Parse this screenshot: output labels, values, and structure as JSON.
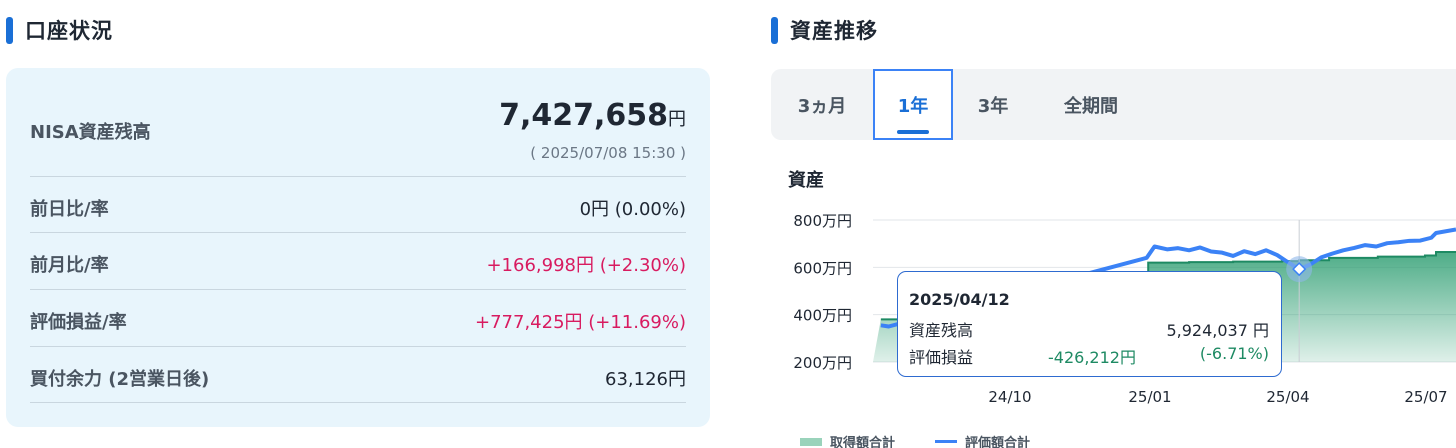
{
  "account": {
    "title": "口座状況",
    "nisa_label": "NISA資産残高",
    "nisa_value": "7,427,658",
    "nisa_unit": "円",
    "timestamp": "( 2025/07/08 15:30 )",
    "rows": [
      {
        "label": "前日比/率",
        "value": "0円 (0.00%)"
      },
      {
        "label": "前月比/率",
        "value": "+166,998円 (+2.30%)"
      },
      {
        "label": "評価損益/率",
        "value": "+777,425円 (+11.69%)"
      },
      {
        "label": "買付余力 (2営業日後)",
        "value": "63,126円"
      }
    ]
  },
  "history": {
    "title": "資産推移",
    "tabs": [
      "3ヵ月",
      "1年",
      "3年",
      "全期間"
    ],
    "active_tab": "1年",
    "chart_label": "資産",
    "tooltip": {
      "date": "2025/04/12",
      "row1_label": "資産残高",
      "row1_value": "5,924,037 円",
      "row2_label": "評価損益",
      "row2_value": "-426,212円",
      "row2_pct": "(-6.71%)"
    },
    "legend": [
      "取得額合計",
      "評価額合計"
    ]
  },
  "colors": {
    "accent": "#1a6fd6",
    "positive": "#d81b60",
    "negative_tooltip": "#1e8a63",
    "line": "#3b82f6",
    "area": "#2e9e72"
  },
  "chart_data": {
    "type": "line",
    "ylabel": "",
    "y_ticks": [
      "800万円",
      "600万円",
      "400万円",
      "200万円"
    ],
    "y_tick_values": [
      800,
      600,
      400,
      200
    ],
    "ylim": [
      200,
      800
    ],
    "x_ticks": [
      "24/10",
      "25/01",
      "25/04",
      "25/07"
    ],
    "x_tick_values": [
      "2024-10",
      "2025-01",
      "2025-04",
      "2025-07"
    ],
    "grid": true,
    "legend_position": "bottom",
    "series": [
      {
        "name": "取得額合計",
        "style": "area",
        "x": [
          "2024-07-20",
          "2024-08-15",
          "2024-09-15",
          "2024-10-15",
          "2024-11-15",
          "2024-12-15",
          "2025-01-05",
          "2025-01-06",
          "2025-02-01",
          "2025-03-01",
          "2025-04-01",
          "2025-04-12",
          "2025-05-01",
          "2025-06-01",
          "2025-07-01",
          "2025-07-08"
        ],
        "values": [
          380,
          380,
          380,
          380,
          380,
          380,
          380,
          620,
          622,
          624,
          626,
          630,
          640,
          645,
          650,
          665
        ]
      },
      {
        "name": "評価額合計",
        "style": "line",
        "x": [
          "2024-07-20",
          "2024-07-25",
          "2025-01-05",
          "2025-01-10",
          "2025-01-18",
          "2025-01-25",
          "2025-02-01",
          "2025-02-08",
          "2025-02-15",
          "2025-02-22",
          "2025-03-01",
          "2025-03-08",
          "2025-03-15",
          "2025-03-22",
          "2025-03-29",
          "2025-04-05",
          "2025-04-12",
          "2025-04-19",
          "2025-04-26",
          "2025-05-03",
          "2025-05-10",
          "2025-05-17",
          "2025-05-24",
          "2025-05-31",
          "2025-06-07",
          "2025-06-14",
          "2025-06-21",
          "2025-06-28",
          "2025-07-05",
          "2025-07-08"
        ],
        "values": [
          355,
          350,
          640,
          688,
          676,
          681,
          672,
          684,
          667,
          662,
          648,
          668,
          656,
          672,
          652,
          621,
          592,
          612,
          642,
          658,
          672,
          682,
          694,
          688,
          702,
          706,
          712,
          713,
          725,
          745
        ]
      }
    ],
    "highlight": {
      "x": "2025-04-12",
      "value": 592.4
    }
  }
}
